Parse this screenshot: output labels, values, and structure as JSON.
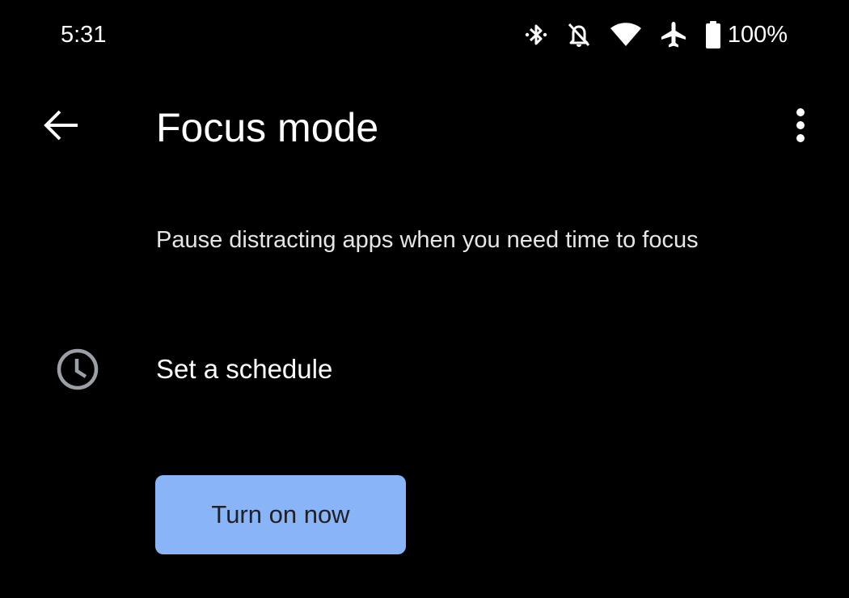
{
  "status_bar": {
    "time": "5:31",
    "battery_percent": "100%",
    "icons": [
      "bluetooth-icon",
      "notifications-off-icon",
      "wifi-icon",
      "airplane-icon",
      "battery-icon"
    ]
  },
  "toolbar": {
    "back_icon": "arrow-left-icon",
    "title": "Focus mode",
    "more_icon": "more-vert-icon"
  },
  "description": "Pause distracting apps when you need time to focus",
  "schedule": {
    "icon": "clock-icon",
    "label": "Set a schedule"
  },
  "primary_action": {
    "label": "Turn on now"
  },
  "colors": {
    "background": "#000000",
    "accent": "#8ab4f8",
    "button_text": "#202124",
    "icon_gray": "#9aa0a6"
  }
}
